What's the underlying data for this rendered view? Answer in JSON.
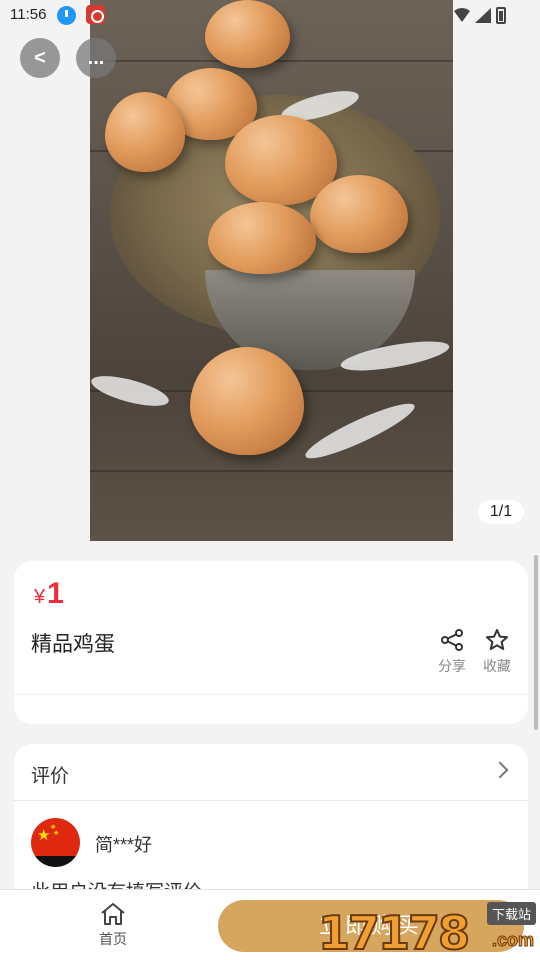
{
  "status_bar": {
    "time": "11:56"
  },
  "gallery": {
    "page_indicator": "1/1",
    "back_label": "<",
    "more_label": "..."
  },
  "product": {
    "currency": "¥",
    "price": "1",
    "title": "精品鸡蛋",
    "share_label": "分享",
    "favorite_label": "收藏"
  },
  "reviews": {
    "title": "评价",
    "items": [
      {
        "user": "简***好",
        "text": "此用户没有填写评价"
      }
    ]
  },
  "bottom_bar": {
    "home_label": "首页",
    "buy_label": "立即购买"
  },
  "watermark": {
    "digits": "17178",
    "suffix": ".com",
    "tag": "下载站"
  },
  "colors": {
    "price": "#ee2c3b",
    "buy_button": "#d6a55e",
    "page_background": "#f3f3f3"
  }
}
